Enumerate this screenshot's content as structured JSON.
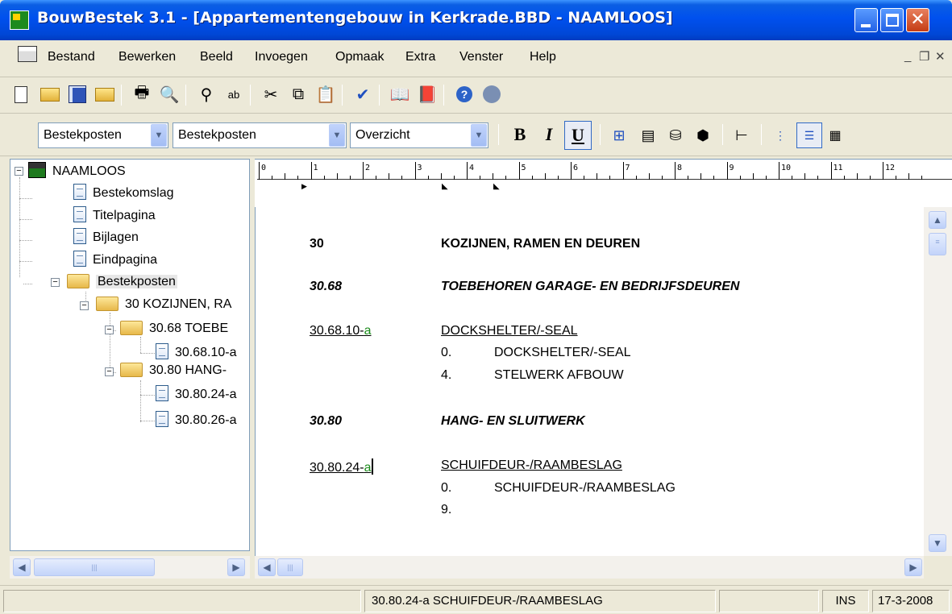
{
  "window": {
    "title": "BouwBestek 3.1 - [Appartementengebouw in Kerkrade.BBD - NAAMLOOS]"
  },
  "menu": {
    "items": [
      "Bestand",
      "Bewerken",
      "Beeld",
      "Invoegen",
      "Opmaak",
      "Extra",
      "Venster",
      "Help"
    ],
    "mdi_controls": [
      "_",
      "̅□",
      "×"
    ]
  },
  "toolbar1": {
    "icons": [
      "new-icon",
      "open-icon",
      "save-icon",
      "open-folder-icon",
      "print-icon",
      "print-preview-icon",
      "find-icon",
      "replace-icon",
      "cut-icon",
      "copy-icon",
      "paste-icon",
      "spellcheck-icon",
      "book-icon",
      "book2-icon",
      "help-icon",
      "help2-icon"
    ]
  },
  "toolbar2": {
    "combo1": "Bestekposten",
    "combo2": "Bestekposten",
    "combo3": "Overzicht",
    "bold": "B",
    "italic": "I",
    "underline": "U"
  },
  "tree": {
    "root": "NAAMLOOS",
    "items": [
      "Bestekomslag",
      "Titelpagina",
      "Bijlagen",
      "Eindpagina",
      "Bestekposten",
      "30 KOZIJNEN, RA",
      "30.68 TOEBE",
      "30.68.10-a",
      "30.80 HANG-",
      "30.80.24-a",
      "30.80.26-a"
    ]
  },
  "ruler": {
    "numbers": [
      "0",
      "1",
      "2",
      "3",
      "4",
      "5",
      "6",
      "7",
      "8",
      "9",
      "10",
      "11",
      "12"
    ]
  },
  "document": {
    "h1_code": "30",
    "h1_title": "KOZIJNEN, RAMEN EN DEUREN",
    "h2a_code": "30.68",
    "h2a_title": "TOEBEHOREN GARAGE- EN BEDRIJFSDEUREN",
    "p1_code": "30.68.10-",
    "p1_suffix": "a",
    "p1_title": "DOCKSHELTER/-SEAL",
    "p1_l1_num": "0.",
    "p1_l1_text": "DOCKSHELTER/-SEAL",
    "p1_l2_num": "4.",
    "p1_l2_text": "STELWERK AFBOUW",
    "h2b_code": "30.80",
    "h2b_title": "HANG- EN SLUITWERK",
    "p2_code": "30.80.24-",
    "p2_suffix": "a",
    "p2_title": "SCHUIFDEUR-/RAAMBESLAG",
    "p2_l1_num": "0.",
    "p2_l1_text": "SCHUIFDEUR-/RAAMBESLAG",
    "p2_l2_num": "9."
  },
  "status": {
    "current": "30.80.24-a   SCHUIFDEUR-/RAAMBESLAG",
    "mode": "INS",
    "date": "17-3-2008"
  },
  "colors": {
    "suffix_green": "#1a8a1a",
    "titlebar": "#0050ee"
  }
}
